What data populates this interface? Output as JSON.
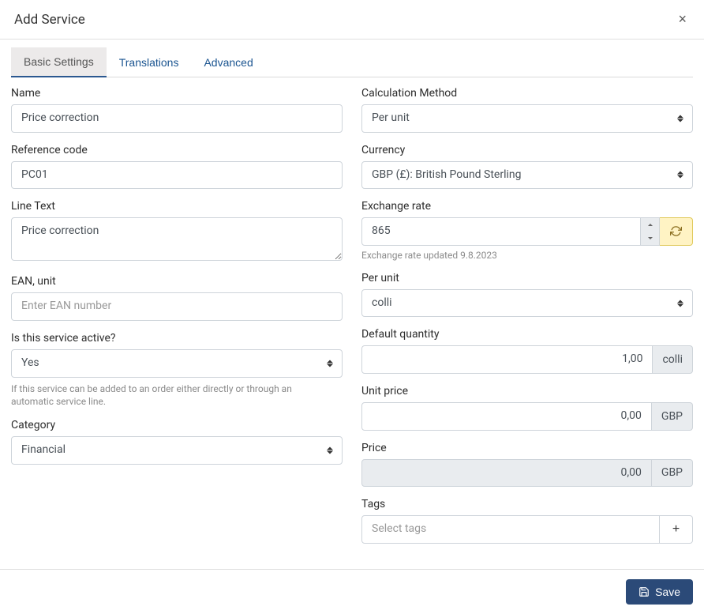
{
  "header": {
    "title": "Add Service"
  },
  "tabs": {
    "basic": "Basic Settings",
    "translations": "Translations",
    "advanced": "Advanced"
  },
  "left": {
    "name": {
      "label": "Name",
      "value": "Price correction"
    },
    "reference": {
      "label": "Reference code",
      "value": "PC01"
    },
    "linetext": {
      "label": "Line Text",
      "value": "Price correction"
    },
    "ean": {
      "label": "EAN, unit",
      "placeholder": "Enter EAN number"
    },
    "active": {
      "label": "Is this service active?",
      "value": "Yes",
      "help": "If this service can be added to an order either directly or through an automatic service line."
    },
    "category": {
      "label": "Category",
      "value": "Financial"
    }
  },
  "right": {
    "calcmethod": {
      "label": "Calculation Method",
      "value": "Per unit"
    },
    "currency": {
      "label": "Currency",
      "value": "GBP (£): British Pound Sterling"
    },
    "exchange": {
      "label": "Exchange rate",
      "value": "865",
      "hint": "Exchange rate updated 9.8.2023"
    },
    "perunit": {
      "label": "Per unit",
      "value": "colli"
    },
    "defaultqty": {
      "label": "Default quantity",
      "value": "1,00",
      "suffix": "colli"
    },
    "unitprice": {
      "label": "Unit price",
      "value": "0,00",
      "suffix": "GBP"
    },
    "price": {
      "label": "Price",
      "value": "0,00",
      "suffix": "GBP"
    },
    "tags": {
      "label": "Tags",
      "placeholder": "Select tags"
    }
  },
  "footer": {
    "save": "Save"
  }
}
